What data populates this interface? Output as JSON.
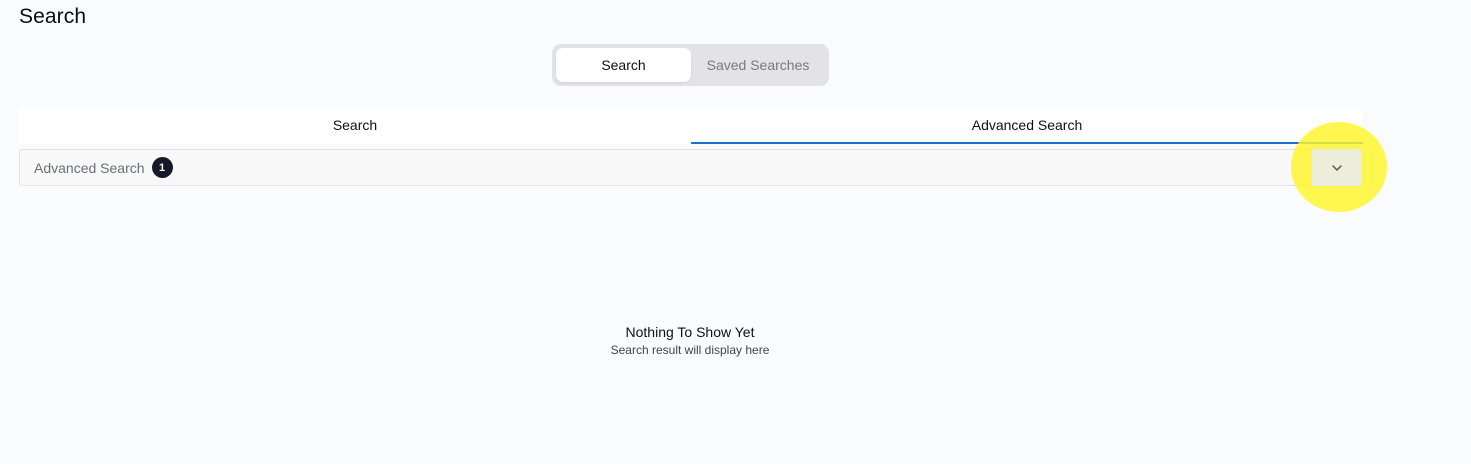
{
  "page": {
    "title": "Search"
  },
  "mode_toggle": {
    "options": [
      "Search",
      "Saved Searches"
    ],
    "selected": "Search"
  },
  "tabs": [
    {
      "label": "Search",
      "active": false
    },
    {
      "label": "Advanced Search",
      "active": true
    }
  ],
  "accordion": {
    "label": "Advanced Search",
    "badge_count": "1",
    "toggle_icon": "chevron-down-icon"
  },
  "empty_state": {
    "title": "Nothing To Show Yet",
    "subtitle": "Search result will display here"
  },
  "colors": {
    "active_tab_underline": "#1a73c7",
    "badge_bg": "#16192a",
    "highlight": "#fff528"
  }
}
